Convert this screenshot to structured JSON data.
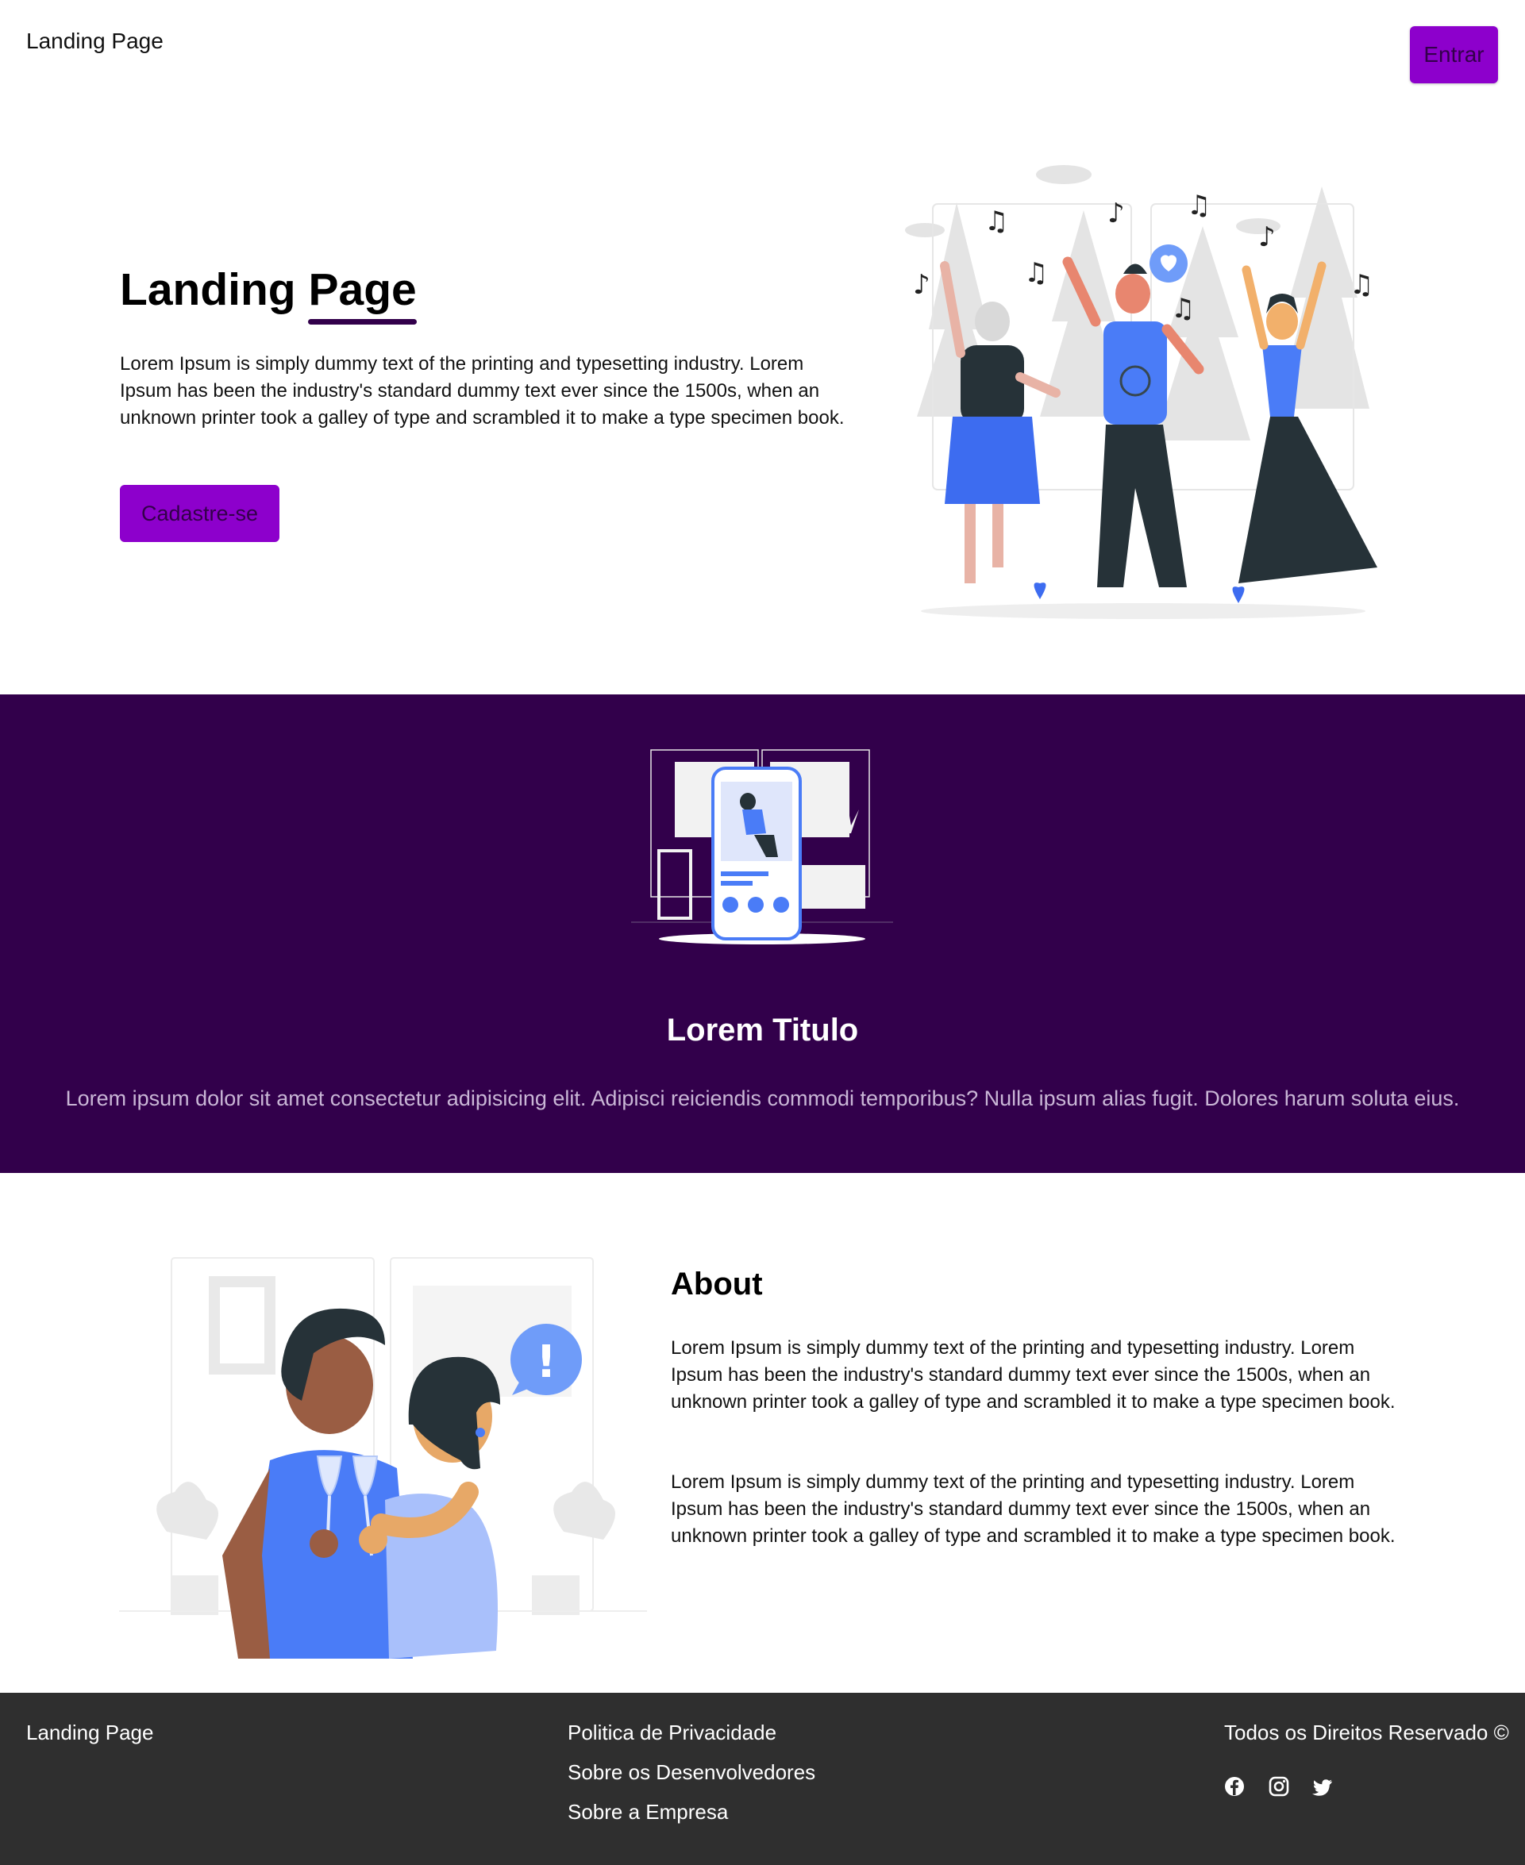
{
  "header": {
    "brand": "Landing Page",
    "login_label": "Entrar"
  },
  "hero": {
    "title_part1": "Landing",
    "title_part2": "Page",
    "text": "Lorem Ipsum is simply dummy text of the printing and typesetting industry. Lorem Ipsum has been the industry's standard dummy text ever since the 1500s, when an unknown printer took a galley of type and scrambled it to make a type specimen book.",
    "cta_label": "Cadastre-se",
    "illustration": "people-dancing-illustration"
  },
  "feature": {
    "illustration": "phone-app-illustration",
    "title": "Lorem Titulo",
    "text": "Lorem ipsum dolor sit amet consectetur adipisicing elit. Adipisci reiciendis commodi temporibus? Nulla ipsum alias fugit. Dolores harum soluta eius."
  },
  "about": {
    "illustration": "couple-toasting-illustration",
    "title": "About",
    "paragraphs": [
      "Lorem Ipsum is simply dummy text of the printing and typesetting industry. Lorem Ipsum has been the industry's standard dummy text ever since the 1500s, when an unknown printer took a galley of type and scrambled it to make a type specimen book.",
      "Lorem Ipsum is simply dummy text of the printing and typesetting industry. Lorem Ipsum has been the industry's standard dummy text ever since the 1500s, when an unknown printer took a galley of type and scrambled it to make a type specimen book."
    ]
  },
  "footer": {
    "brand": "Landing Page",
    "links": [
      "Politica de Privacidade",
      "Sobre os Desenvolvedores",
      "Sobre a Empresa"
    ],
    "copyright": "Todos os Direitos Reservado ©",
    "social_icons": [
      "facebook-icon",
      "instagram-icon",
      "twitter-icon"
    ]
  },
  "colors": {
    "accent": "#8d00cc",
    "band": "#32004b",
    "illustration_blue": "#4a7cf7",
    "footer": "#2f2f2f"
  }
}
